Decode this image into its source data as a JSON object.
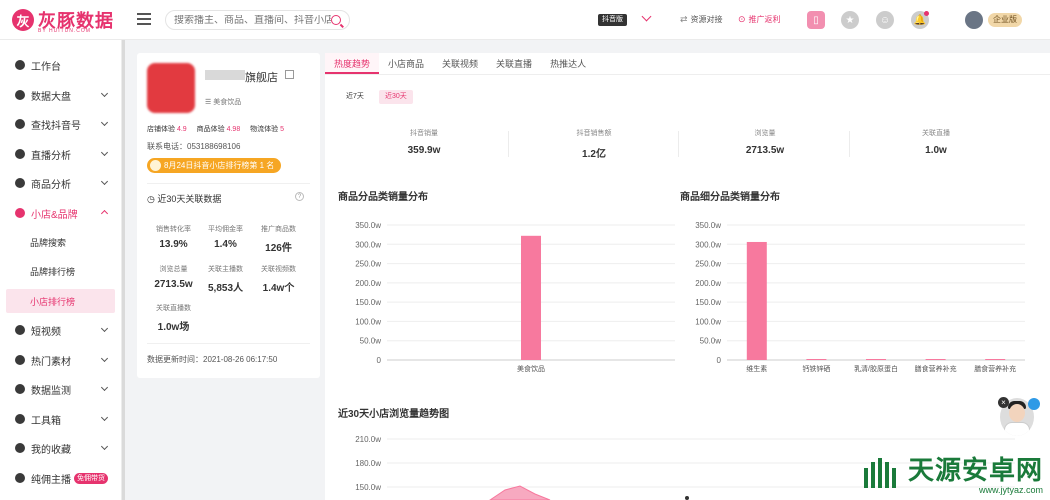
{
  "colors": {
    "accent": "#e6336e",
    "bar": "#f7799e",
    "sidebar_active_bg": "#fbe4ec"
  },
  "topbar": {
    "logo_text": "灰豚数据",
    "logo_sub": "BY HUITUN.COM",
    "search_placeholder": "搜索播主、商品、直播间、抖音小店",
    "platform": "抖音版",
    "link_resource": "资源对接",
    "link_promo": "推广返利",
    "enterprise": "企业版"
  },
  "sidebar": {
    "items": [
      {
        "label": "工作台",
        "icon": "dashboard-icon"
      },
      {
        "label": "数据大盘",
        "icon": "chart-icon"
      },
      {
        "label": "查找抖音号",
        "icon": "search-user-icon"
      },
      {
        "label": "直播分析",
        "icon": "live-icon"
      },
      {
        "label": "商品分析",
        "icon": "goods-icon"
      },
      {
        "label": "小店&品牌",
        "icon": "shop-icon"
      }
    ],
    "sub_items": [
      {
        "label": "品牌搜索"
      },
      {
        "label": "品牌排行榜"
      },
      {
        "label": "小店排行榜"
      }
    ],
    "items_after": [
      {
        "label": "短视频",
        "icon": "video-icon"
      },
      {
        "label": "热门素材",
        "icon": "fire-icon"
      },
      {
        "label": "数据监测",
        "icon": "monitor-icon"
      },
      {
        "label": "工具箱",
        "icon": "toolbox-icon"
      },
      {
        "label": "我的收藏",
        "icon": "star-icon"
      },
      {
        "label": "纯佣主播",
        "icon": "user-icon",
        "badge": "免佣带货"
      }
    ]
  },
  "shop": {
    "name_suffix": "旗舰店",
    "category": "美食饮品",
    "score_shop_label": "店铺体验",
    "score_shop": "4.9",
    "score_goods_label": "商品体验",
    "score_goods": "4.98",
    "score_logistics_label": "物流体验",
    "score_logistics": "5",
    "phone": "联系电话：053188698106",
    "rank_badge": "8月24日抖音小店排行榜第 1 名",
    "stats_title": "近30天关联数据",
    "stats": [
      {
        "label": "销售转化率",
        "value": "13.9%"
      },
      {
        "label": "平均佣金率",
        "value": "1.4%"
      },
      {
        "label": "推广商品数",
        "value": "126件"
      },
      {
        "label": "浏览总量",
        "value": "2713.5w"
      },
      {
        "label": "关联主播数",
        "value": "5,853人"
      },
      {
        "label": "关联视频数",
        "value": "1.4w个"
      },
      {
        "label": "关联直播数",
        "value": "1.0w场"
      }
    ],
    "update_time": "数据更新时间：2021-08-26 06:17:50"
  },
  "main": {
    "tabs": [
      "热度趋势",
      "小店商品",
      "关联视频",
      "关联直播",
      "热推达人"
    ],
    "ranges": [
      "近7天",
      "近30天"
    ],
    "kpis": [
      {
        "label": "抖音销量",
        "value": "359.9w"
      },
      {
        "label": "抖音销售额",
        "value": "1.2亿"
      },
      {
        "label": "浏览量",
        "value": "2713.5w"
      },
      {
        "label": "关联直播",
        "value": "1.0w"
      }
    ],
    "chart1_title": "商品分品类销量分布",
    "chart2_title": "商品细分品类销量分布",
    "chart3_title": "近30天小店浏览量趋势图"
  },
  "chart_data": [
    {
      "type": "bar",
      "title": "商品分品类销量分布",
      "categories": [
        "美食饮品"
      ],
      "values": [
        322
      ],
      "unit": "w",
      "ylim": [
        0,
        350
      ],
      "yticks": [
        "0",
        "50.0w",
        "100.0w",
        "150.0w",
        "200.0w",
        "250.0w",
        "300.0w",
        "350.0w"
      ],
      "grid": true
    },
    {
      "type": "bar",
      "title": "商品细分品类销量分布",
      "categories": [
        "维生素",
        "钙铁锌硒",
        "乳清/胶原蛋白",
        "膳食营养补充",
        "膳食营养补充"
      ],
      "values": [
        306,
        2,
        2,
        2,
        1
      ],
      "unit": "w",
      "ylim": [
        0,
        350
      ],
      "yticks": [
        "0",
        "50.0w",
        "100.0w",
        "150.0w",
        "200.0w",
        "250.0w",
        "300.0w",
        "350.0w"
      ],
      "grid": true
    },
    {
      "type": "area",
      "title": "近30天小店浏览量趋势图",
      "yticks": [
        "120.0w",
        "150.0w",
        "180.0w",
        "210.0w"
      ],
      "ylim": [
        120,
        210
      ],
      "grid": true
    }
  ],
  "watermark": {
    "title": "天源安卓网",
    "url": "www.jytyaz.com"
  }
}
